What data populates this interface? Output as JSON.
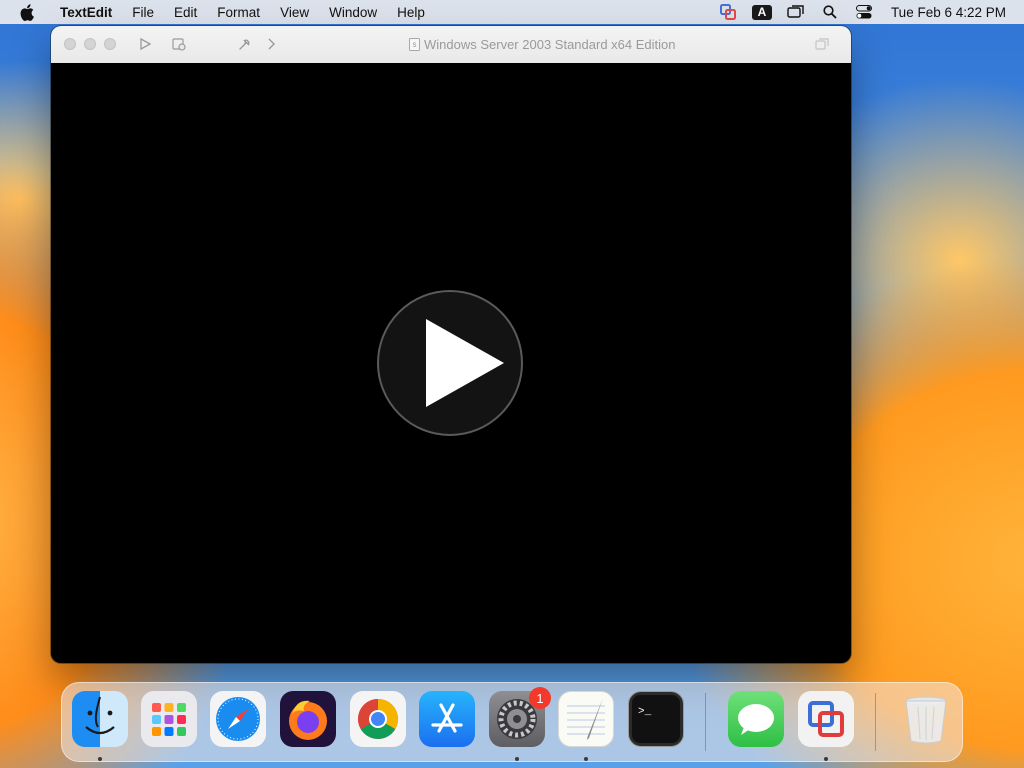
{
  "menubar": {
    "app_name": "TextEdit",
    "items": [
      "File",
      "Edit",
      "Format",
      "View",
      "Window",
      "Help"
    ],
    "input_source": "A",
    "clock": "Tue Feb 6  4:22 PM"
  },
  "window": {
    "title": "Windows Server 2003 Standard x64 Edition"
  },
  "dock": {
    "apps": [
      {
        "name": "finder-icon",
        "running": true
      },
      {
        "name": "launchpad-icon",
        "running": false
      },
      {
        "name": "safari-icon",
        "running": false
      },
      {
        "name": "firefox-icon",
        "running": false
      },
      {
        "name": "chrome-icon",
        "running": false
      },
      {
        "name": "app-store-icon",
        "running": false
      },
      {
        "name": "system-settings-icon",
        "running": true,
        "badge": "1"
      },
      {
        "name": "textedit-icon",
        "running": true
      },
      {
        "name": "terminal-icon",
        "running": false
      },
      {
        "name": "messages-icon",
        "running": false
      },
      {
        "name": "vmware-fusion-icon",
        "running": true
      },
      {
        "name": "trash-icon",
        "running": false
      }
    ]
  },
  "colors": {
    "badge": "#f2392b",
    "messages_green": "#35c759",
    "appstore_blue": "#1b8cf5"
  }
}
